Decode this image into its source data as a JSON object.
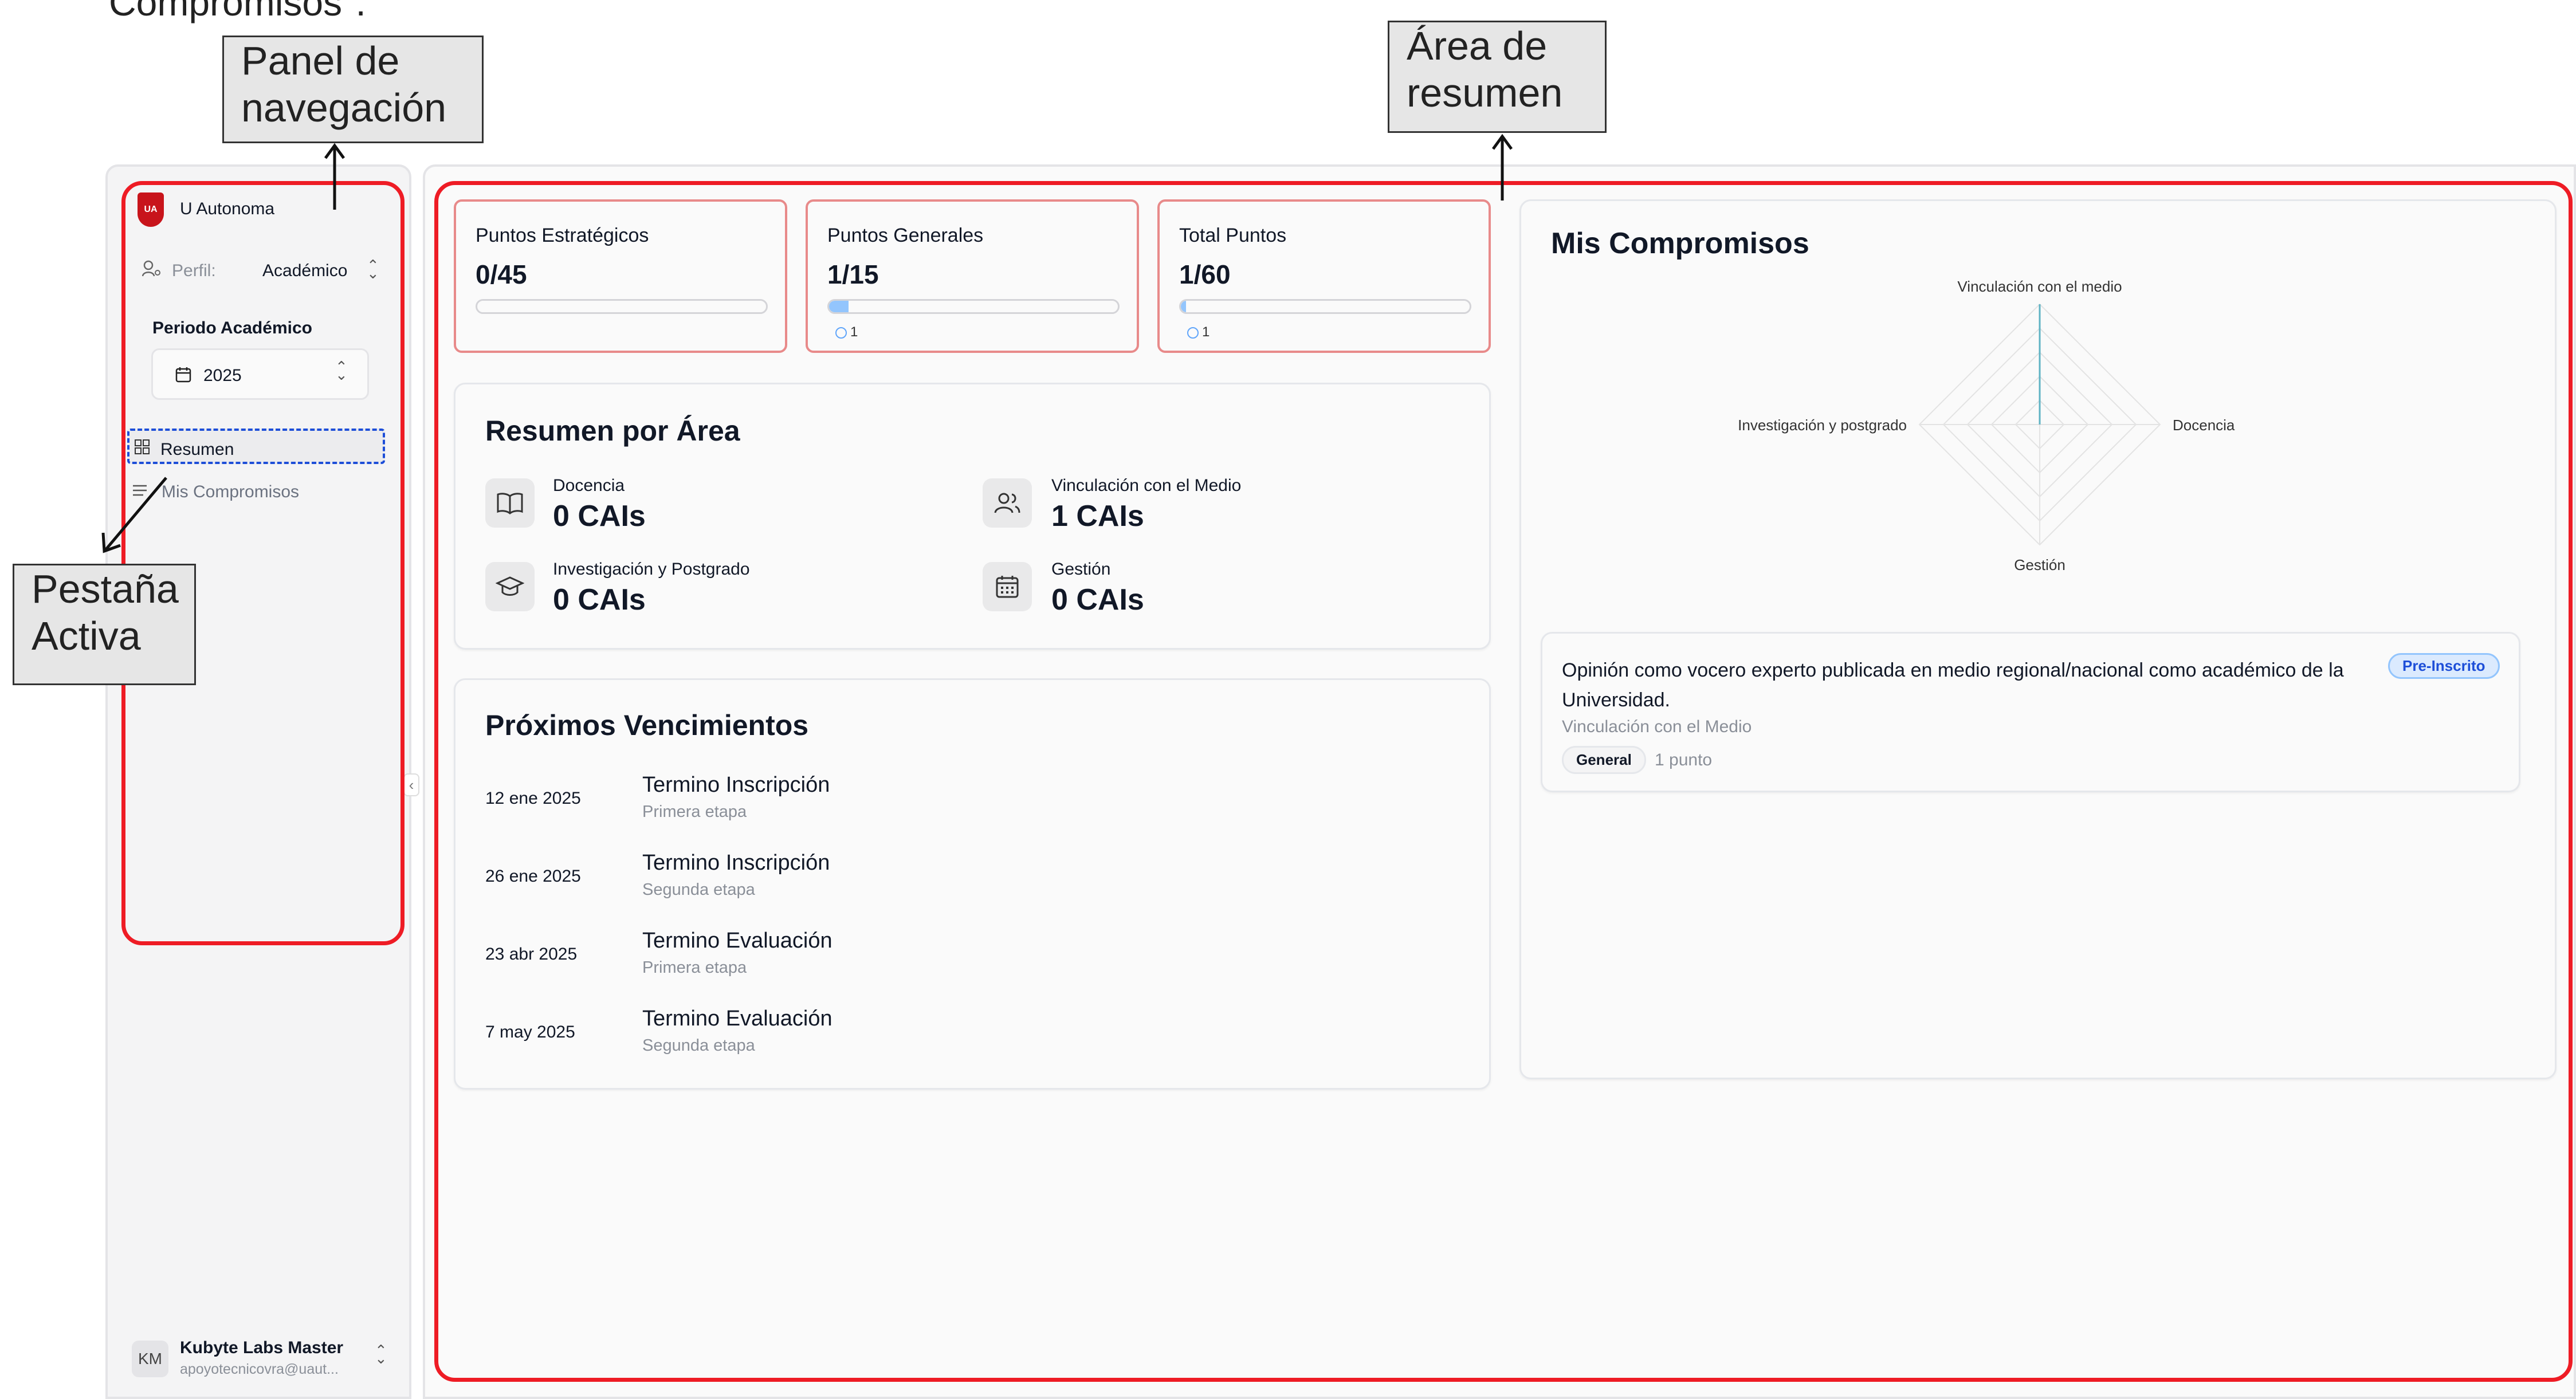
{
  "top_cut_text": "Compromisos\".",
  "annotations": {
    "panel_nav": "Panel de\nnavegación",
    "area_resumen": "Área de\nresumen",
    "pestana_activa": "Pestaña\nActiva"
  },
  "sidebar": {
    "org_logo_text": "UA",
    "org_name": "U Autonoma",
    "profile_label": "Perfil:",
    "profile_value": "Académico",
    "period_label": "Periodo Académico",
    "period_value": "2025",
    "nav": [
      {
        "label": "Resumen",
        "icon": "grid-icon",
        "active": true
      },
      {
        "label": "Mis Compromisos",
        "icon": "list-icon",
        "active": false
      }
    ],
    "user": {
      "initials": "KM",
      "name": "Kubyte Labs Master",
      "email": "apoyotecnicovra@uaut..."
    }
  },
  "points": [
    {
      "title": "Puntos Estratégicos",
      "value": "0/45",
      "progress": 0,
      "marker": ""
    },
    {
      "title": "Puntos Generales",
      "value": "1/15",
      "progress": 0.067,
      "marker": "1"
    },
    {
      "title": "Total Puntos",
      "value": "1/60",
      "progress": 0.017,
      "marker": "1"
    }
  ],
  "summary": {
    "title": "Resumen por Área",
    "areas": [
      {
        "name": "Docencia",
        "value": "0 CAIs",
        "icon": "book-icon"
      },
      {
        "name": "Vinculación con el Medio",
        "value": "1 CAIs",
        "icon": "users-icon"
      },
      {
        "name": "Investigación y Postgrado",
        "value": "0 CAIs",
        "icon": "graduation-cap-icon"
      },
      {
        "name": "Gestión",
        "value": "0 CAIs",
        "icon": "calendar-icon"
      }
    ]
  },
  "deadlines": {
    "title": "Próximos Vencimientos",
    "items": [
      {
        "date": "12 ene 2025",
        "title": "Termino Inscripción",
        "sub": "Primera etapa"
      },
      {
        "date": "26 ene 2025",
        "title": "Termino Inscripción",
        "sub": "Segunda etapa"
      },
      {
        "date": "23 abr 2025",
        "title": "Termino Evaluación",
        "sub": "Primera etapa"
      },
      {
        "date": "7 may 2025",
        "title": "Termino Evaluación",
        "sub": "Segunda etapa"
      }
    ]
  },
  "commitments": {
    "title": "Mis Compromisos",
    "radar_axes": [
      "Vinculación con el medio",
      "Docencia",
      "Gestión",
      "Investigación y postgrado"
    ],
    "radar_values": [
      1,
      0,
      0,
      0
    ],
    "item": {
      "title": "Opinión como vocero experto publicada en medio regional/nacional como académico de la Universidad.",
      "area": "Vinculación con el Medio",
      "status": "Pre-Inscrito",
      "tag": "General",
      "points": "1 punto"
    }
  },
  "colors": {
    "highlight_red": "#ee1c25",
    "active_dash": "#1d4ed8",
    "progress_fill": "#93c5fd",
    "radar_line": "#5fb3c4"
  }
}
